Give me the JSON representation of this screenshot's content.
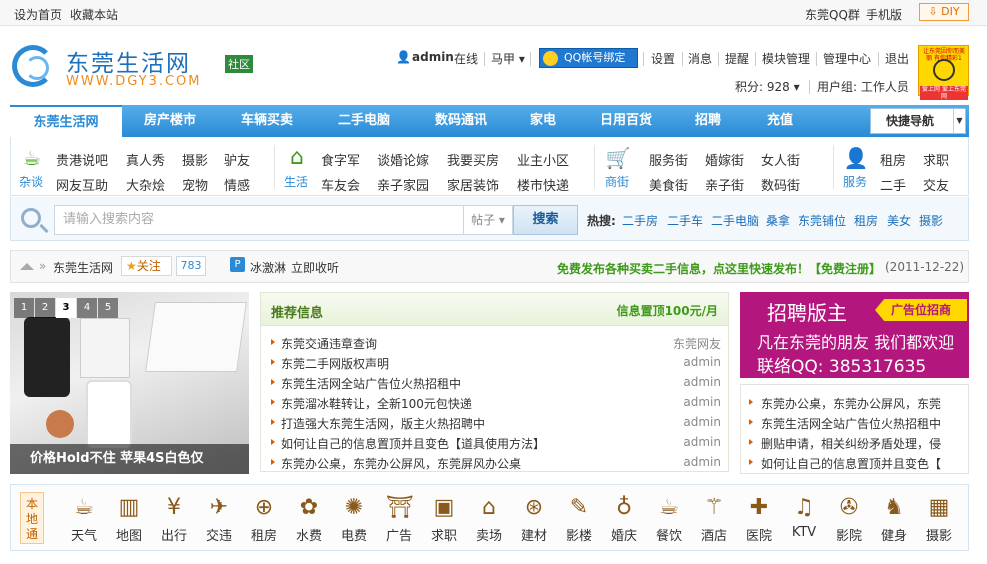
{
  "topbar": {
    "set_home": "设为首页",
    "bookmark": "收藏本站",
    "qq_group": "东莞QQ群",
    "mobile": "手机版",
    "diy": "⇩ DIY"
  },
  "header": {
    "logo_title": "东莞生活网",
    "logo_url": "WWW.DGY3.COM",
    "logo_badge": "社区",
    "username": "admin",
    "online": "在线",
    "horse": "马甲 ▾",
    "qq_bind": "QQ帐号绑定",
    "links": [
      "设置",
      "消息",
      "提醒",
      "模块管理",
      "管理中心",
      "退出"
    ],
    "points": "积分: 928 ▾",
    "usergroup": "用户组: 工作人员",
    "smiley_text_top": "让东莞因你而美丽 有你精彩1",
    "smiley_text_bottom": "爱上网 爱上东莞网"
  },
  "nav": {
    "items": [
      "东莞生活网",
      "房产楼市",
      "车辆买卖",
      "二手电脑",
      "数码通讯",
      "家电",
      "日用百货",
      "招聘",
      "充值"
    ],
    "quick": "快捷导航"
  },
  "categories": [
    {
      "name": "杂谈",
      "icon": "coffee-icon",
      "links": [
        "贵港说吧",
        "真人秀",
        "摄影",
        "驴友",
        "网友互助",
        "大杂烩",
        "宠物",
        "情感"
      ]
    },
    {
      "name": "生活",
      "icon": "house-icon",
      "links": [
        "食字军",
        "谈婚论嫁",
        "我要买房",
        "业主小区",
        "车友会",
        "亲子家园",
        "家居装饰",
        "楼市快递"
      ]
    },
    {
      "name": "商街",
      "icon": "cart-icon",
      "links": [
        "服务街",
        "婚嫁街",
        "女人街",
        "美食街",
        "亲子街",
        "数码街"
      ]
    },
    {
      "name": "服务",
      "icon": "person-icon",
      "links": [
        "租房",
        "求职",
        "二手",
        "交友"
      ]
    }
  ],
  "search": {
    "placeholder": "请输入搜索内容",
    "type": "帖子 ▾",
    "button": "搜索",
    "hot_label": "热搜:",
    "hot": [
      "二手房",
      "二手车",
      "二手电脑",
      "桑拿",
      "东莞铺位",
      "租房",
      "美女",
      "摄影"
    ]
  },
  "breadcrumb": {
    "site": "东莞生活网",
    "follow": "关注",
    "count": "783",
    "user": "冰激淋",
    "collect": "立即收听",
    "notice": "免费发布各种买卖二手信息，点这里快速发布！【免费注册】",
    "date": "(2011-12-22)"
  },
  "slideshow": {
    "numbers": [
      "1",
      "2",
      "3",
      "4",
      "5"
    ],
    "current": "3",
    "caption": "价格Hold不住 苹果4S白色仅"
  },
  "recommend": {
    "title": "推荐信息",
    "top_price": "信息置顶100元/月",
    "rows": [
      {
        "title": "东莞交通违章查询",
        "author": "东莞网友"
      },
      {
        "title": "东莞二手网版权声明",
        "author": "admin"
      },
      {
        "title": "东莞生活网全站广告位火热招租中",
        "author": "admin"
      },
      {
        "title": "东莞溜冰鞋转让，全新100元包快递",
        "author": "admin"
      },
      {
        "title": "打造强大东莞生活网，版主火热招聘中",
        "author": "admin"
      },
      {
        "title": "如何让自己的信息置顶并且变色【道具使用方法】",
        "author": "admin"
      },
      {
        "title": "东莞办公桌，东莞办公屏风，东莞屏风办公桌",
        "author": "admin"
      }
    ]
  },
  "ad": {
    "title": "招聘版主",
    "tag": "广告位招商",
    "line1": "凡在东莞的朋友 我们都欢迎",
    "line2": "联络QQ: 385317635"
  },
  "side_list": [
    "东莞办公桌，东莞办公屏风，东莞",
    "东莞生活网全站广告位火热招租中",
    "删贴申请，相关纠纷矛盾处理，侵",
    "如何让自己的信息置顶并且变色【"
  ],
  "local": {
    "tag": "本地通",
    "items": [
      {
        "label": "天气",
        "glyph": "☕",
        "icon": "weather-icon"
      },
      {
        "label": "地图",
        "glyph": "▥",
        "icon": "map-icon"
      },
      {
        "label": "出行",
        "glyph": "¥",
        "icon": "travel-icon"
      },
      {
        "label": "交违",
        "glyph": "✈",
        "icon": "traffic-icon"
      },
      {
        "label": "租房",
        "glyph": "⊕",
        "icon": "rent-icon"
      },
      {
        "label": "水费",
        "glyph": "✿",
        "icon": "water-icon"
      },
      {
        "label": "电费",
        "glyph": "✺",
        "icon": "electric-icon"
      },
      {
        "label": "广告",
        "glyph": "⛩",
        "icon": "ad-icon"
      },
      {
        "label": "求职",
        "glyph": "▣",
        "icon": "job-icon"
      },
      {
        "label": "卖场",
        "glyph": "⌂",
        "icon": "mall-icon"
      },
      {
        "label": "建材",
        "glyph": "⊛",
        "icon": "build-icon"
      },
      {
        "label": "影楼",
        "glyph": "✎",
        "icon": "studio-icon"
      },
      {
        "label": "婚庆",
        "glyph": "♁",
        "icon": "wedding-icon"
      },
      {
        "label": "餐饮",
        "glyph": "☕",
        "icon": "dining-icon"
      },
      {
        "label": "酒店",
        "glyph": "⚚",
        "icon": "hotel-icon"
      },
      {
        "label": "医院",
        "glyph": "✚",
        "icon": "hospital-icon"
      },
      {
        "label": "KTV",
        "glyph": "♫",
        "icon": "ktv-icon"
      },
      {
        "label": "影院",
        "glyph": "✇",
        "icon": "cinema-icon"
      },
      {
        "label": "健身",
        "glyph": "♞",
        "icon": "fitness-icon"
      },
      {
        "label": "摄影",
        "glyph": "▦",
        "icon": "photo-icon"
      }
    ]
  },
  "colors": {
    "brand": "#2a8ad6",
    "accent_green": "#3d9a1a",
    "ad_bg": "#b3177e",
    "diy": "#e06b00"
  }
}
